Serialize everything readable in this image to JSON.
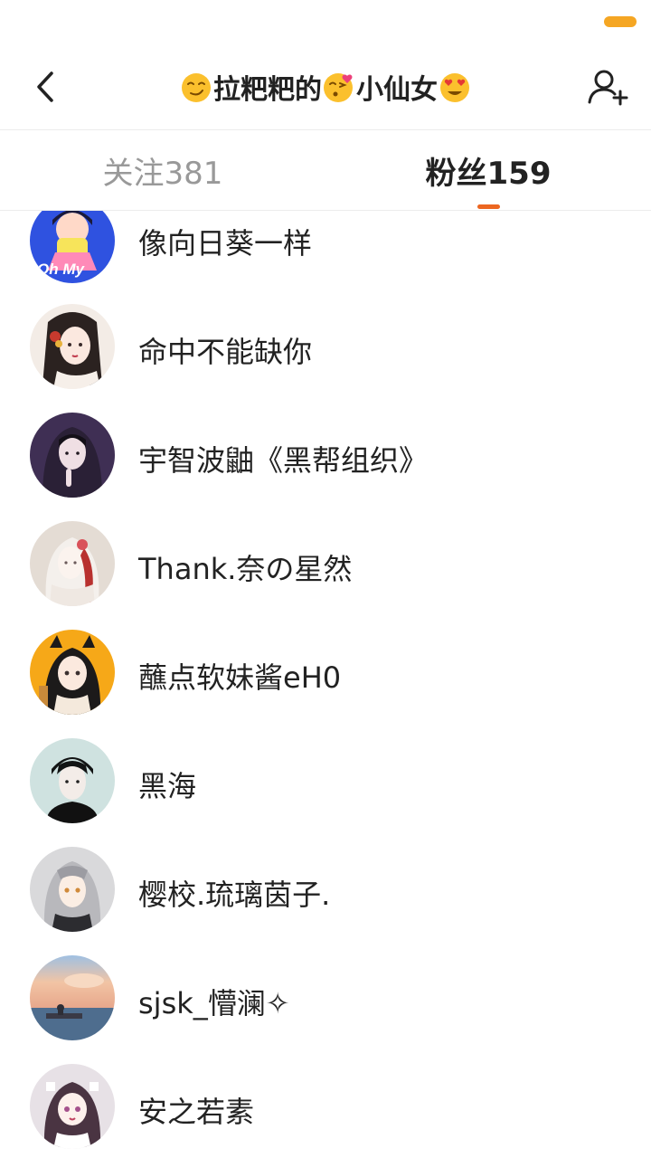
{
  "header": {
    "title_part1": "拉粑粑的",
    "title_part2": "小仙女",
    "emoji_left": "smirk-emoji",
    "emoji_middle": "kiss-heart-emoji",
    "emoji_right": "heart-eyes-emoji"
  },
  "tabs": {
    "follow_label": "关注381",
    "fans_label": "粉丝159",
    "active": "fans"
  },
  "colors": {
    "accent": "#ec6620",
    "battery": "#f5a623",
    "inactive_tab": "#999999"
  },
  "fans": [
    {
      "name": "像向日葵一样",
      "avatar": "anime-oh-my-avatar"
    },
    {
      "name": "命中不能缺你",
      "avatar": "anime-girl-avatar"
    },
    {
      "name": "宇智波鼬《黑帮组织》",
      "avatar": "hooded-boy-avatar"
    },
    {
      "name": "Thank.奈の星然",
      "avatar": "white-hair-girl-avatar"
    },
    {
      "name": "蘸点软妹酱eH0",
      "avatar": "cat-ear-girl-avatar"
    },
    {
      "name": "黑海",
      "avatar": "dark-hair-boy-avatar"
    },
    {
      "name": "樱校.琉璃茵子.",
      "avatar": "silver-hair-girl-avatar"
    },
    {
      "name": "sjsk_懵澜✧",
      "avatar": "sunset-sea-avatar"
    },
    {
      "name": "安之若素",
      "avatar": "twin-tail-girl-avatar"
    }
  ]
}
